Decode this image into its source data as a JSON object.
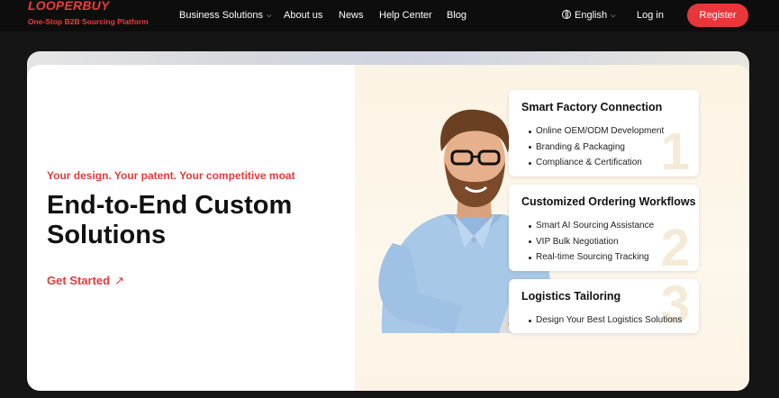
{
  "nav": {
    "logo": "LOOPERBUY",
    "logo_subtitle": "One-Stop B2B Sourcing Platform",
    "links": [
      "Business Solutions",
      "About us",
      "News",
      "Help Center",
      "Blog"
    ],
    "language": "English",
    "login": "Log in",
    "register": "Register"
  },
  "hero": {
    "tagline": "Your design. Your patent. Your competitive moat",
    "headline": "End-to-End Custom Solutions",
    "cta": "Get Started",
    "cta_arrow": "↗"
  },
  "features": [
    {
      "number": "1",
      "title": "Smart Factory Connection",
      "items": [
        "Online OEM/ODM Development",
        "Branding & Packaging",
        "Compliance & Certification"
      ]
    },
    {
      "number": "2",
      "title": "Customized Ordering Workflows",
      "items": [
        "Smart AI Sourcing Assistance",
        "VIP Bulk Negotiation",
        "Real-time Sourcing Tracking"
      ]
    },
    {
      "number": "3",
      "title": "Logistics Tailoring",
      "items": [
        "Design Your Best Logistics Solutions"
      ]
    }
  ],
  "colors": {
    "brand_red": "#e8363a",
    "nav_bg": "#0d0d0d",
    "hero_right_bg": "#fbf3e3"
  },
  "icons": {
    "language": "globe-icon",
    "dropdown": "chevron-down-icon",
    "cta": "arrow-up-right-icon"
  }
}
